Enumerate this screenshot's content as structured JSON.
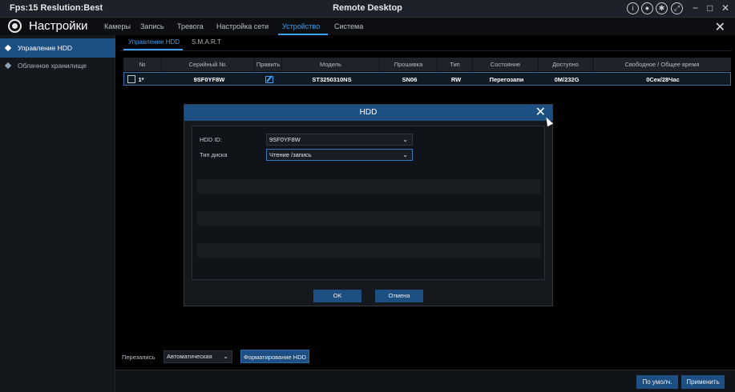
{
  "remote_bar": {
    "left_text": "Fps:15 Reslution:Best",
    "title": "Remote Desktop",
    "icons": [
      "info-icon",
      "record-icon",
      "gear-icon",
      "fullscreen-icon"
    ],
    "minimize": "−",
    "maximize": "□",
    "close": "✕"
  },
  "header": {
    "title": "Настройки",
    "tabs": [
      {
        "label": "Камеры"
      },
      {
        "label": "Запись"
      },
      {
        "label": "Тревога"
      },
      {
        "label": "Настройка сети"
      },
      {
        "label": "Устройство",
        "active": true
      },
      {
        "label": "Система"
      }
    ],
    "close": "✕"
  },
  "sidebar": {
    "items": [
      {
        "label": "Управление HDD",
        "active": true
      },
      {
        "label": "Облачное хранилище"
      }
    ]
  },
  "subtabs": [
    {
      "label": "Управление HDD",
      "active": true
    },
    {
      "label": "S.M.A.R.T"
    }
  ],
  "table": {
    "headers": [
      "№",
      "Серийный №.",
      "Править",
      "Модель",
      "Прошивка",
      "Тип",
      "Состояние",
      "Доступно",
      "Свободное / Общее время"
    ],
    "rows": [
      {
        "num": "1*",
        "serial": "9SF0YF8W",
        "model": "ST3250310NS",
        "firmware": "SN06",
        "type": "RW",
        "state": "Перегозапи",
        "available": "0M/232G",
        "time": "0Сек/28Час"
      }
    ]
  },
  "bottom": {
    "overwrite_label": "Перезапись",
    "overwrite_value": "Автоматическая",
    "format_button": "Форматирование HDD",
    "default_button": "По умолч.",
    "apply_button": "Применить"
  },
  "dialog": {
    "title": "HDD",
    "close": "✕",
    "hdd_id_label": "HDD ID:",
    "hdd_id_value": "9SF0YF8W",
    "disk_type_label": "Тип диска",
    "disk_type_value": "Чтение /запись",
    "ok": "OK",
    "cancel": "Отмена"
  }
}
